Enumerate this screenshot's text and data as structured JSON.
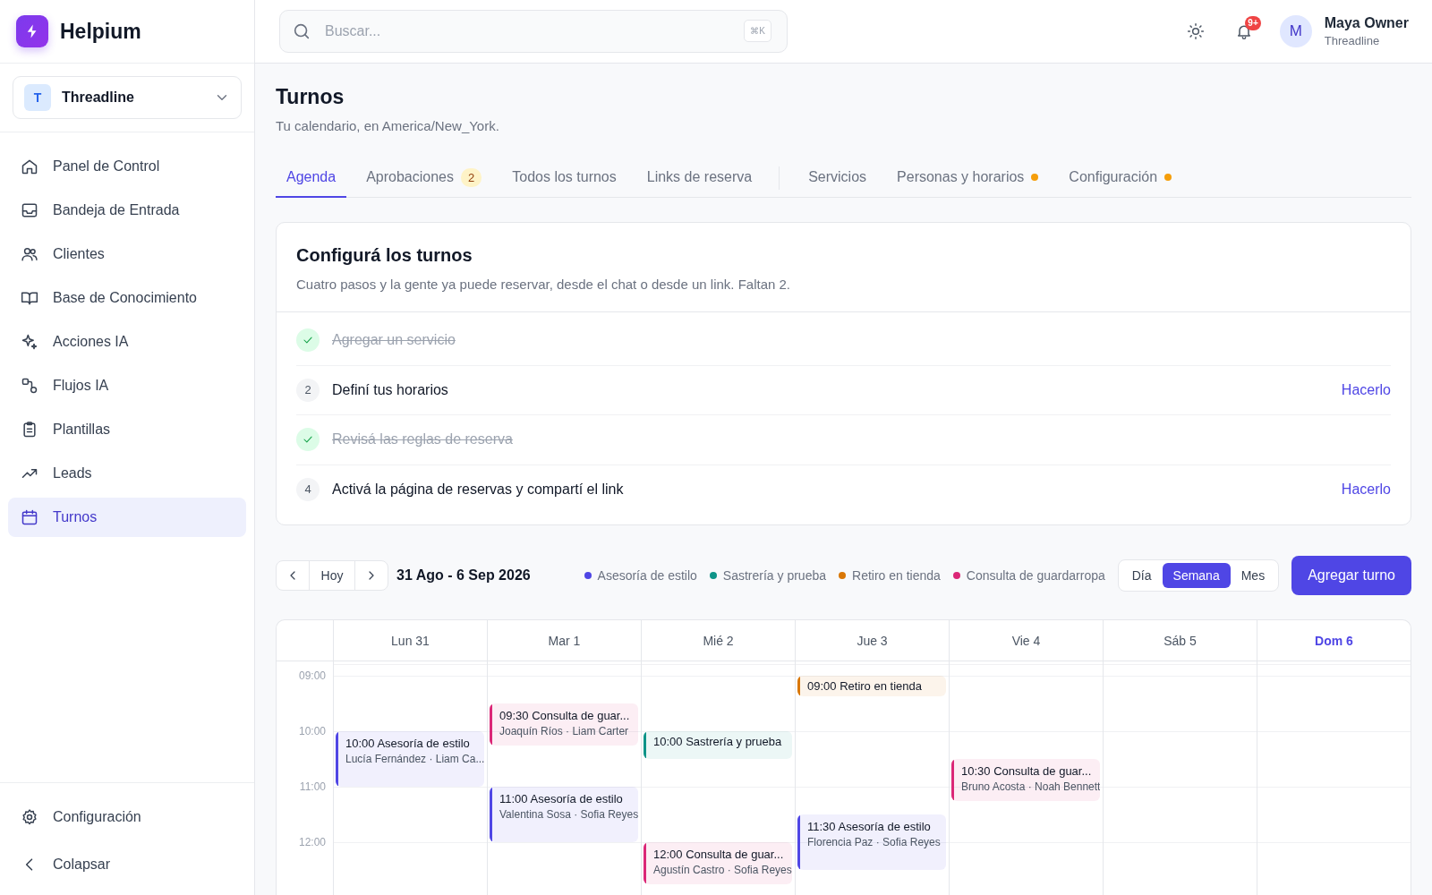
{
  "app": {
    "name": "Helpium"
  },
  "workspace": {
    "initial": "T",
    "name": "Threadline"
  },
  "nav": [
    {
      "label": "Panel de Control",
      "selected": false
    },
    {
      "label": "Bandeja de Entrada",
      "selected": false
    },
    {
      "label": "Clientes",
      "selected": false
    },
    {
      "label": "Base de Conocimiento",
      "selected": false
    },
    {
      "label": "Acciones IA",
      "selected": false
    },
    {
      "label": "Flujos IA",
      "selected": false
    },
    {
      "label": "Plantillas",
      "selected": false
    },
    {
      "label": "Leads",
      "selected": false
    },
    {
      "label": "Turnos",
      "selected": true
    }
  ],
  "sidebar_footer": [
    {
      "label": "Configuración"
    },
    {
      "label": "Colapsar"
    }
  ],
  "search": {
    "placeholder": "Buscar...",
    "shortcut": "⌘K"
  },
  "notifications": {
    "badge": "9+"
  },
  "user": {
    "initial": "M",
    "name": "Maya Owner",
    "org": "Threadline"
  },
  "page": {
    "title": "Turnos",
    "subtitle": "Tu calendario, en America/New_York."
  },
  "tab_groups": [
    {
      "tabs": [
        {
          "label": "Agenda",
          "selected": true
        },
        {
          "label": "Aprobaciones",
          "selected": false,
          "badge": "2"
        },
        {
          "label": "Todos los turnos",
          "selected": false
        },
        {
          "label": "Links de reserva",
          "selected": false
        }
      ]
    },
    {
      "tabs": [
        {
          "label": "Servicios",
          "selected": false
        },
        {
          "label": "Personas y horarios",
          "selected": false,
          "attention": true
        },
        {
          "label": "Configuración",
          "selected": false,
          "attention": true
        }
      ]
    }
  ],
  "setup": {
    "title": "Configurá los turnos",
    "subtitle": "Cuatro pasos y la gente ya puede reservar, desde el chat o desde un link. Faltan 2.",
    "steps": [
      {
        "label": "Agregar un servicio",
        "done": true
      },
      {
        "number": "2",
        "label": "Definí tus horarios",
        "done": false,
        "action": "Hacerlo"
      },
      {
        "label": "Revisá las reglas de reserva",
        "done": true
      },
      {
        "number": "4",
        "label": "Activá la página de reservas y compartí el link",
        "done": false,
        "action": "Hacerlo"
      }
    ]
  },
  "toolbar": {
    "today": "Hoy",
    "range": "31 Ago - 6 Sep 2026",
    "legend": [
      {
        "label": "Asesoría de estilo",
        "color": "#4f46e5"
      },
      {
        "label": "Sastrería y prueba",
        "color": "#0d9488"
      },
      {
        "label": "Retiro en tienda",
        "color": "#d97706"
      },
      {
        "label": "Consulta de guardarropa",
        "color": "#db2777"
      }
    ],
    "views": [
      {
        "label": "Día",
        "selected": false
      },
      {
        "label": "Semana",
        "selected": true
      },
      {
        "label": "Mes",
        "selected": false
      }
    ],
    "add_button": "Agregar turno"
  },
  "calendar": {
    "hours": [
      "09:00",
      "10:00",
      "11:00",
      "12:00"
    ],
    "days": [
      {
        "label": "Lun 31",
        "today": false,
        "events": [
          {
            "start": "10:00",
            "kind": "hour",
            "title": "Asesoría de estilo",
            "people": "Lucía Fernández · Liam Ca...",
            "color": "#4f46e5"
          }
        ]
      },
      {
        "label": "Mar 1",
        "today": false,
        "events": [
          {
            "start": "09:30",
            "kind": "long",
            "title": "Consulta de guar...",
            "people": "Joaquín Ríos · Liam Carter",
            "color": "#db2777"
          },
          {
            "start": "11:00",
            "kind": "hour",
            "title": "Asesoría de estilo",
            "people": "Valentina Sosa · Sofia Reyes",
            "color": "#4f46e5"
          }
        ]
      },
      {
        "label": "Mié 2",
        "today": false,
        "events": [
          {
            "start": "10:00",
            "kind": "half",
            "title": "Sastrería y prueba",
            "color": "#0d9488"
          },
          {
            "start": "12:00",
            "kind": "long",
            "title": "Consulta de guar...",
            "people": "Agustín Castro · Sofia Reyes",
            "color": "#db2777"
          }
        ]
      },
      {
        "label": "Jue 3",
        "today": false,
        "events": [
          {
            "start": "09:00",
            "kind": "brief",
            "title": "Retiro en tienda",
            "color": "#d97706"
          },
          {
            "start": "11:30",
            "kind": "hour",
            "title": "Asesoría de estilo",
            "people": "Florencia Paz · Sofia Reyes",
            "color": "#4f46e5"
          }
        ]
      },
      {
        "label": "Vie 4",
        "today": false,
        "events": [
          {
            "start": "10:30",
            "kind": "long",
            "title": "Consulta de guar...",
            "people": "Bruno Acosta · Noah Bennett",
            "color": "#db2777"
          }
        ]
      },
      {
        "label": "Sáb 5",
        "today": false
      },
      {
        "label": "Dom 6",
        "today": true
      }
    ]
  }
}
